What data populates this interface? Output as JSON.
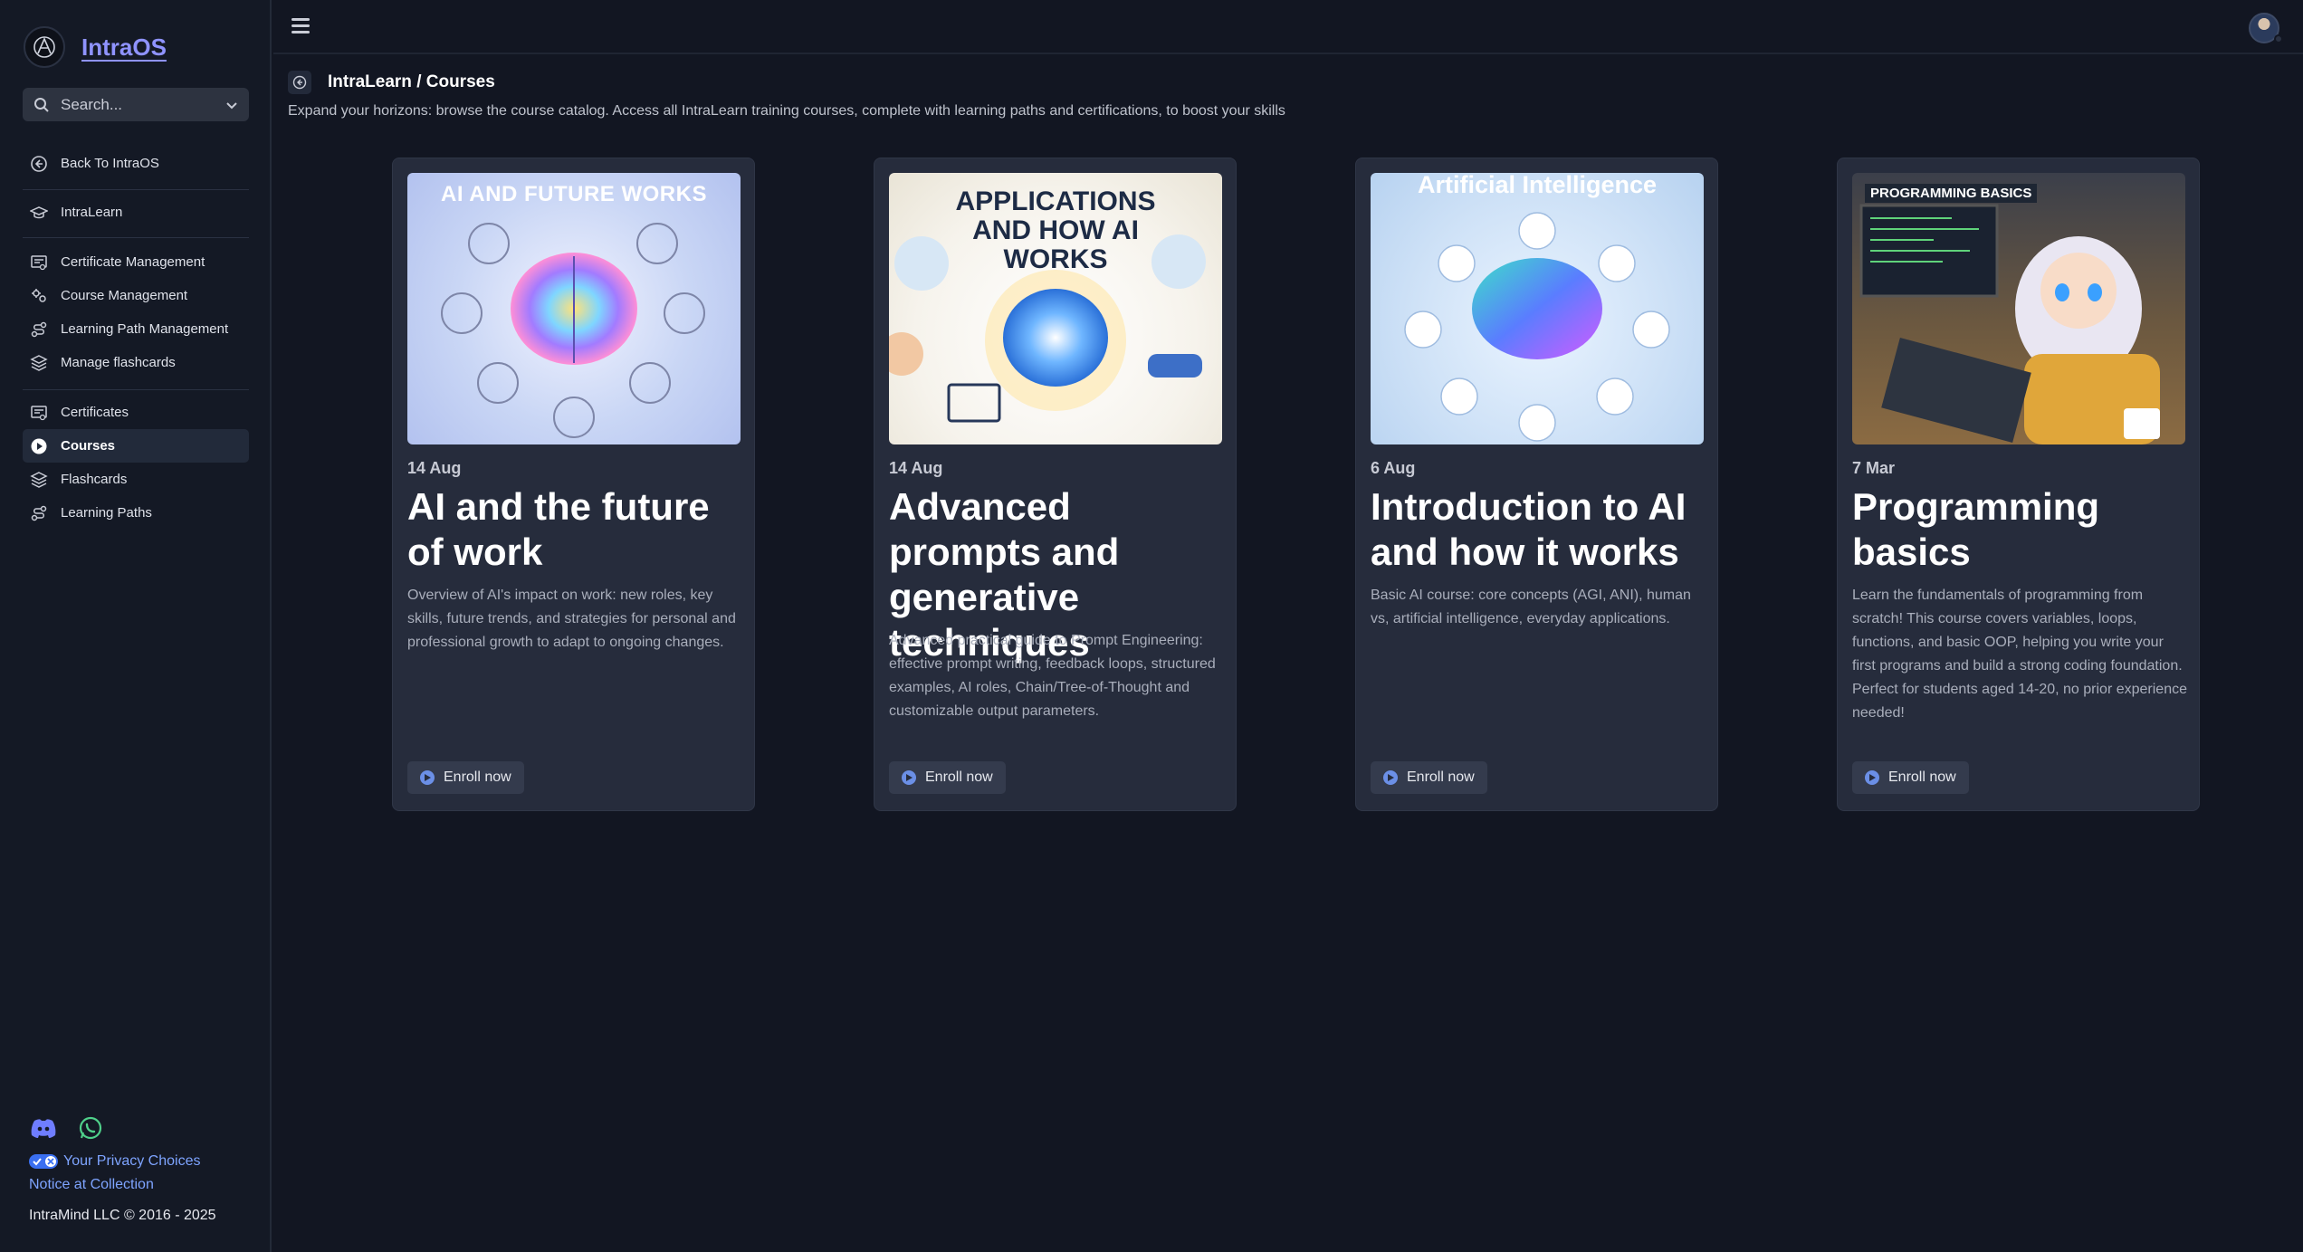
{
  "app": {
    "name": "IntraOS"
  },
  "search": {
    "label": "Search..."
  },
  "sidebar": {
    "group1": [
      {
        "label": "Back To IntraOS",
        "icon": "arrow-left-circle-icon"
      }
    ],
    "group2": [
      {
        "label": "IntraLearn",
        "icon": "graduation-cap-icon"
      }
    ],
    "group3": [
      {
        "label": "Certificate Management",
        "icon": "certificate-icon"
      },
      {
        "label": "Course Management",
        "icon": "gears-icon"
      },
      {
        "label": "Learning Path Management",
        "icon": "route-icon"
      },
      {
        "label": "Manage flashcards",
        "icon": "layers-icon"
      }
    ],
    "group4": [
      {
        "label": "Certificates",
        "icon": "certificate-icon"
      },
      {
        "label": "Courses",
        "icon": "play-circle-icon",
        "active": true
      },
      {
        "label": "Flashcards",
        "icon": "layers-icon"
      },
      {
        "label": "Learning Paths",
        "icon": "route-icon"
      }
    ]
  },
  "footer": {
    "privacy": "Your Privacy Choices",
    "notice": "Notice at Collection",
    "copyright": "IntraMind LLC © 2016 - 2025"
  },
  "header": {
    "title": "IntraLearn / Courses",
    "description": "Expand your horizons: browse the course catalog. Access all IntraLearn training courses, complete with learning paths and certifications, to boost your skills"
  },
  "courses": [
    {
      "date": "14 Aug",
      "title": "AI and the future of work",
      "description": "Overview of AI's impact on work: new roles, key skills, future trends, and strategies for personal and professional growth to adapt to ongoing changes.",
      "image_caption": "AI AND FUTURE WORKS",
      "enroll": "Enroll now"
    },
    {
      "date": "14 Aug",
      "title": "Advanced prompts and generative techniques",
      "description": "Advanced practical guide to Prompt Engineering: effective prompt writing, feedback loops, structured examples, AI roles, Chain/Tree-of-Thought and customizable output parameters.",
      "image_caption": "APPLICATIONS AND HOW AI WORKS",
      "enroll": "Enroll now"
    },
    {
      "date": "6 Aug",
      "title": "Introduction to AI and how it works",
      "description": "Basic AI course: core concepts (AGI, ANI), human vs, artificial intelligence, everyday applications.",
      "image_caption": "Artificial Intelligence",
      "enroll": "Enroll now"
    },
    {
      "date": "7 Mar",
      "title": "Programming basics",
      "description": "Learn the fundamentals of programming from scratch! This course covers variables, loops, functions, and basic OOP, helping you write your first programs and build a strong coding foundation. Perfect for students aged 14-20, no prior experience needed!",
      "image_caption": "PROGRAMMING BASICS",
      "enroll": "Enroll now"
    }
  ]
}
